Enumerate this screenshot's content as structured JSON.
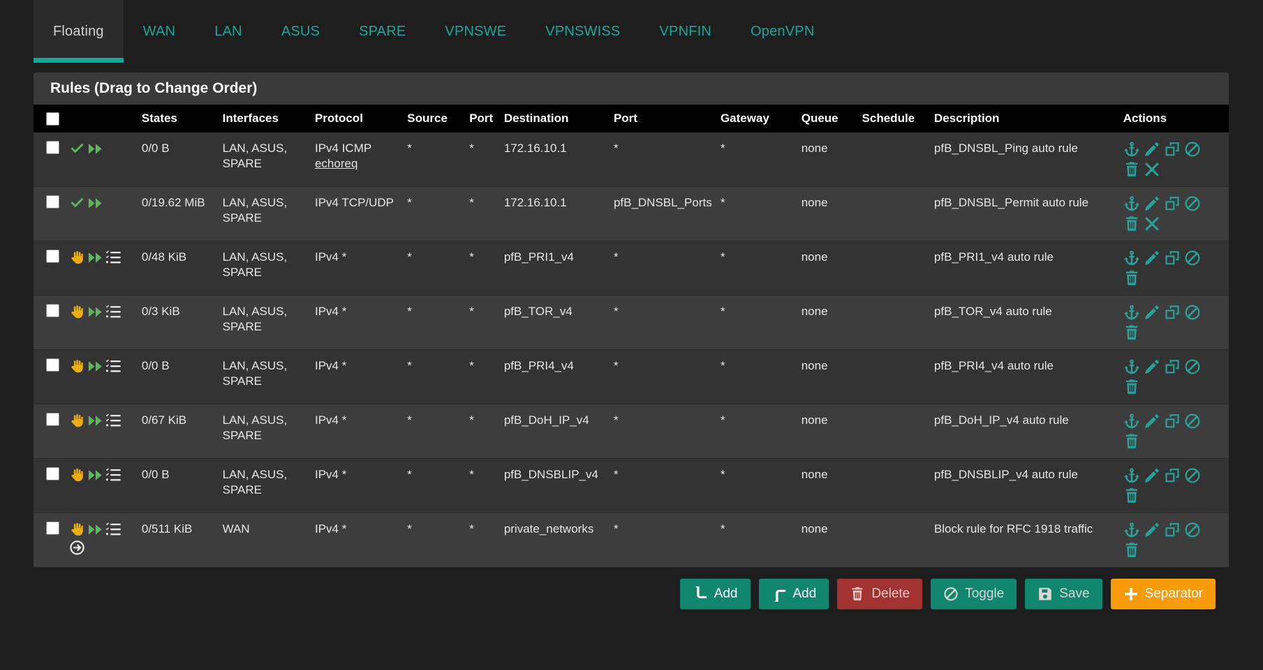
{
  "tabs": [
    {
      "label": "Floating",
      "active": true
    },
    {
      "label": "WAN",
      "active": false
    },
    {
      "label": "LAN",
      "active": false
    },
    {
      "label": "ASUS",
      "active": false
    },
    {
      "label": "SPARE",
      "active": false
    },
    {
      "label": "VPNSWE",
      "active": false
    },
    {
      "label": "VPNSWISS",
      "active": false
    },
    {
      "label": "VPNFIN",
      "active": false
    },
    {
      "label": "OpenVPN",
      "active": false
    }
  ],
  "panel": {
    "title": "Rules (Drag to Change Order)"
  },
  "table": {
    "headers": {
      "checkbox": "",
      "icons": "",
      "states": "States",
      "interfaces": "Interfaces",
      "protocol": "Protocol",
      "source": "Source",
      "source_port": "Port",
      "destination": "Destination",
      "dest_port": "Port",
      "gateway": "Gateway",
      "queue": "Queue",
      "schedule": "Schedule",
      "description": "Description",
      "actions": "Actions"
    },
    "rows": [
      {
        "status_icons": [
          "check-icon",
          "double-arrow-right-icon"
        ],
        "states": "0/0 B",
        "interfaces": "LAN, ASUS, SPARE",
        "protocol": "IPv4 ICMP",
        "protocol_sub": "echoreq",
        "source": "*",
        "source_port": "*",
        "destination": "172.16.10.1",
        "destination_link": false,
        "dest_port": "*",
        "dest_port_link": false,
        "gateway": "*",
        "queue": "none",
        "schedule": "",
        "description": "pfB_DNSBL_Ping auto rule",
        "action_icons": [
          "anchor-icon",
          "pencil-icon",
          "copy-icon",
          "ban-icon",
          "trash-icon",
          "x-icon"
        ]
      },
      {
        "status_icons": [
          "check-icon",
          "double-arrow-right-icon"
        ],
        "states": "0/19.62 MiB",
        "interfaces": "LAN, ASUS, SPARE",
        "protocol": "IPv4 TCP/UDP",
        "protocol_sub": "",
        "source": "*",
        "source_port": "*",
        "destination": "172.16.10.1",
        "destination_link": false,
        "dest_port": "pfB_DNSBL_Ports",
        "dest_port_link": true,
        "gateway": "*",
        "queue": "none",
        "schedule": "",
        "description": "pfB_DNSBL_Permit auto rule",
        "action_icons": [
          "anchor-icon",
          "pencil-icon",
          "copy-icon",
          "ban-icon",
          "trash-icon",
          "x-icon"
        ]
      },
      {
        "status_icons": [
          "hand-block-icon",
          "double-arrow-right-icon",
          "log-list-icon"
        ],
        "states": "0/48 KiB",
        "interfaces": "LAN, ASUS, SPARE",
        "protocol": "IPv4 *",
        "protocol_sub": "",
        "source": "*",
        "source_port": "*",
        "destination": "pfB_PRI1_v4",
        "destination_link": true,
        "dest_port": "*",
        "dest_port_link": false,
        "gateway": "*",
        "queue": "none",
        "schedule": "",
        "description": "pfB_PRI1_v4 auto rule",
        "action_icons": [
          "anchor-icon",
          "pencil-icon",
          "copy-icon",
          "ban-icon",
          "trash-icon"
        ]
      },
      {
        "status_icons": [
          "hand-block-icon",
          "double-arrow-right-icon",
          "log-list-icon"
        ],
        "states": "0/3 KiB",
        "interfaces": "LAN, ASUS, SPARE",
        "protocol": "IPv4 *",
        "protocol_sub": "",
        "source": "*",
        "source_port": "*",
        "destination": "pfB_TOR_v4",
        "destination_link": true,
        "dest_port": "*",
        "dest_port_link": false,
        "gateway": "*",
        "queue": "none",
        "schedule": "",
        "description": "pfB_TOR_v4 auto rule",
        "action_icons": [
          "anchor-icon",
          "pencil-icon",
          "copy-icon",
          "ban-icon",
          "trash-icon"
        ]
      },
      {
        "status_icons": [
          "hand-block-icon",
          "double-arrow-right-icon",
          "log-list-icon"
        ],
        "states": "0/0 B",
        "interfaces": "LAN, ASUS, SPARE",
        "protocol": "IPv4 *",
        "protocol_sub": "",
        "source": "*",
        "source_port": "*",
        "destination": "pfB_PRI4_v4",
        "destination_link": true,
        "dest_port": "*",
        "dest_port_link": false,
        "gateway": "*",
        "queue": "none",
        "schedule": "",
        "description": "pfB_PRI4_v4 auto rule",
        "action_icons": [
          "anchor-icon",
          "pencil-icon",
          "copy-icon",
          "ban-icon",
          "trash-icon"
        ]
      },
      {
        "status_icons": [
          "hand-block-icon",
          "double-arrow-right-icon",
          "log-list-icon"
        ],
        "states": "0/67 KiB",
        "interfaces": "LAN, ASUS, SPARE",
        "protocol": "IPv4 *",
        "protocol_sub": "",
        "source": "*",
        "source_port": "*",
        "destination": "pfB_DoH_IP_v4",
        "destination_link": true,
        "dest_port": "*",
        "dest_port_link": false,
        "gateway": "*",
        "queue": "none",
        "schedule": "",
        "description": "pfB_DoH_IP_v4 auto rule",
        "action_icons": [
          "anchor-icon",
          "pencil-icon",
          "copy-icon",
          "ban-icon",
          "trash-icon"
        ]
      },
      {
        "status_icons": [
          "hand-block-icon",
          "double-arrow-right-icon",
          "log-list-icon"
        ],
        "states": "0/0 B",
        "interfaces": "LAN, ASUS, SPARE",
        "protocol": "IPv4 *",
        "protocol_sub": "",
        "source": "*",
        "source_port": "*",
        "destination": "pfB_DNSBLIP_v4",
        "destination_link": true,
        "dest_port": "*",
        "dest_port_link": false,
        "gateway": "*",
        "queue": "none",
        "schedule": "",
        "description": "pfB_DNSBLIP_v4 auto rule",
        "action_icons": [
          "anchor-icon",
          "pencil-icon",
          "copy-icon",
          "ban-icon",
          "trash-icon"
        ]
      },
      {
        "status_icons": [
          "hand-block-icon",
          "double-arrow-right-icon",
          "log-list-icon",
          "arrow-circle-right-icon"
        ],
        "states": "0/511 KiB",
        "interfaces": "WAN",
        "protocol": "IPv4 *",
        "protocol_sub": "",
        "source": "*",
        "source_port": "*",
        "destination": "private_networks",
        "destination_link": true,
        "dest_port": "*",
        "dest_port_link": false,
        "gateway": "*",
        "queue": "none",
        "schedule": "",
        "description": "Block rule for RFC 1918 traffic",
        "action_icons": [
          "anchor-icon",
          "pencil-icon",
          "copy-icon",
          "ban-icon",
          "trash-icon"
        ]
      }
    ]
  },
  "buttons": [
    {
      "label": "Add",
      "icon": "arrow-up-icon",
      "style": "btn-teal"
    },
    {
      "label": "Add",
      "icon": "arrow-down-icon",
      "style": "btn-teal"
    },
    {
      "label": "Delete",
      "icon": "trash-icon",
      "style": "btn-red"
    },
    {
      "label": "Toggle",
      "icon": "ban-icon",
      "style": "btn-ghost"
    },
    {
      "label": "Save",
      "icon": "save-icon",
      "style": "btn-ghost"
    },
    {
      "label": "Separator",
      "icon": "plus-icon",
      "style": "btn-orange"
    }
  ],
  "colors": {
    "accent_teal": "#2aa198",
    "pass_green": "#5cb85c",
    "block_yellow": "#f0ad0e",
    "danger_red": "#a33232",
    "warning_orange": "#f79b0b",
    "page_bg": "#1e1e1e",
    "panel_bg": "#333333",
    "header_bg": "#000000"
  }
}
